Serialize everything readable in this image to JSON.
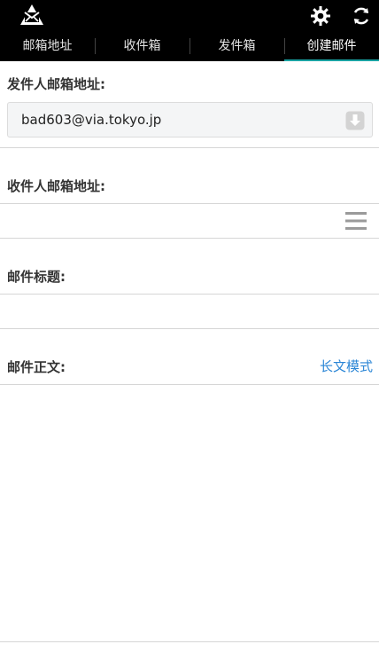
{
  "header": {
    "logo_icon": "mail-recycle-logo-icon",
    "settings_icon": "gear-icon",
    "refresh_icon": "refresh-icon"
  },
  "tabs": [
    {
      "label": "邮箱地址",
      "active": false
    },
    {
      "label": "收件箱",
      "active": false
    },
    {
      "label": "发件箱",
      "active": false
    },
    {
      "label": "创建邮件",
      "active": true
    }
  ],
  "form": {
    "sender_label": "发件人邮箱地址:",
    "sender_value": "bad603@via.tokyo.jp",
    "recipient_label": "收件人邮箱地址:",
    "recipient_value": "",
    "subject_label": "邮件标题:",
    "subject_value": "",
    "body_label": "邮件正文:",
    "body_value": "",
    "long_mode_link": "长文模式"
  },
  "colors": {
    "accent": "#1aa3a3",
    "link": "#2b86d6",
    "topbar": "#000000"
  }
}
